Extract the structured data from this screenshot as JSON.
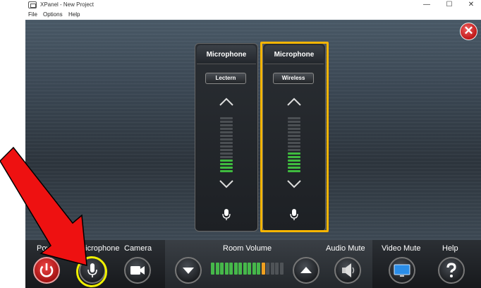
{
  "window": {
    "title": "XPanel - New Project",
    "controls": {
      "minimize": "—",
      "maximize": "☐",
      "close": "✕"
    }
  },
  "menu": [
    "File",
    "Options",
    "Help"
  ],
  "panel": {
    "close_glyph": "✕",
    "mic_strips": [
      {
        "header": "Microphone",
        "source": "Lectern",
        "meter_total": 16,
        "meter_level": 4
      },
      {
        "header": "Microphone",
        "source": "Wireless",
        "meter_total": 16,
        "meter_level": 6
      }
    ]
  },
  "bottom": {
    "power_label": "Power",
    "microphone_label": "Microphone",
    "camera_label": "Camera",
    "room_volume_label": "Room Volume",
    "audio_mute_label": "Audio Mute",
    "video_mute_label": "Video Mute",
    "help_label": "Help",
    "volume": {
      "total_segments": 16,
      "level": 11,
      "peak_segment": 12
    }
  },
  "colors": {
    "highlight": "#f7b500",
    "mic_circle": "#f0f000",
    "arrow": "#ee1111",
    "meter_on": "#3fbb3f"
  }
}
